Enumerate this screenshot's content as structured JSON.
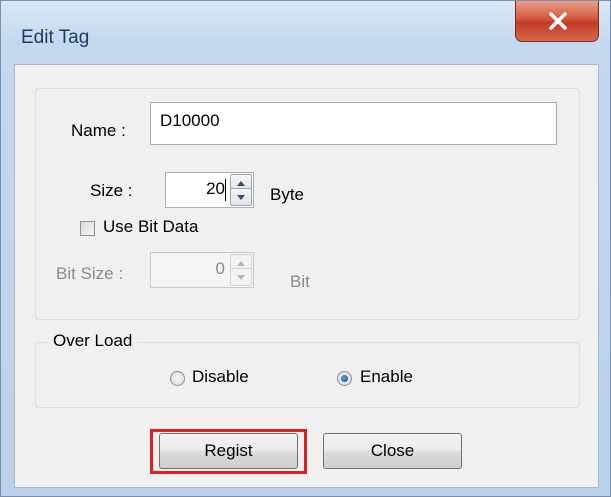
{
  "window": {
    "title": "Edit Tag",
    "close_glyph": "X"
  },
  "form": {
    "name_label": "Name :",
    "name_value": "D10000",
    "size_label": "Size :",
    "size_value": "20",
    "size_unit": "Byte",
    "use_bit_label": "Use Bit Data",
    "use_bit_checked": false,
    "bit_size_label": "Bit Size :",
    "bit_size_value": "0",
    "bit_unit": "Bit"
  },
  "over_load": {
    "legend": "Over Load",
    "options": [
      {
        "label": "Disable",
        "selected": false
      },
      {
        "label": "Enable",
        "selected": true
      }
    ]
  },
  "buttons": {
    "regist_label": "Regist",
    "close_label": "Close"
  },
  "colors": {
    "highlight": "#e02020",
    "close_button": "#c23b22"
  }
}
